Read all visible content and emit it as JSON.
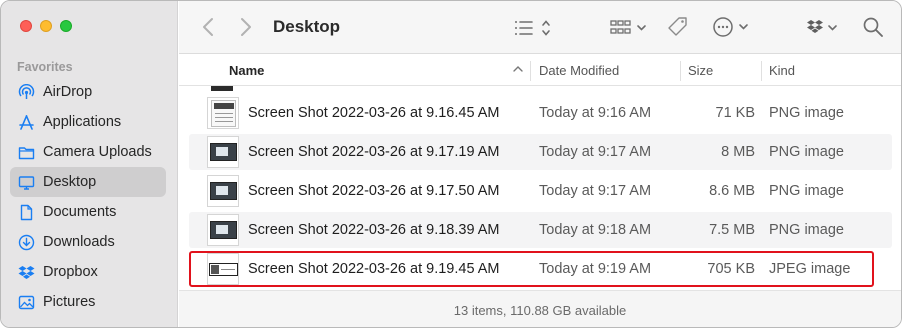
{
  "window": {
    "title": "Desktop"
  },
  "sidebar": {
    "heading": "Favorites",
    "items": [
      {
        "label": "AirDrop",
        "icon": "airdrop-icon",
        "selected": false
      },
      {
        "label": "Applications",
        "icon": "applications-icon",
        "selected": false
      },
      {
        "label": "Camera Uploads",
        "icon": "folder-icon",
        "selected": false
      },
      {
        "label": "Desktop",
        "icon": "desktop-icon",
        "selected": true
      },
      {
        "label": "Documents",
        "icon": "document-icon",
        "selected": false
      },
      {
        "label": "Downloads",
        "icon": "downloads-icon",
        "selected": false
      },
      {
        "label": "Dropbox",
        "icon": "dropbox-icon",
        "selected": false
      },
      {
        "label": "Pictures",
        "icon": "pictures-icon",
        "selected": false
      }
    ]
  },
  "toolbar": {
    "back_icon": "chevron-left-icon",
    "forward_icon": "chevron-right-icon",
    "view_icon": "list-view-icon",
    "group_icon": "group-icon",
    "tag_icon": "tag-icon",
    "action_icon": "more-icon",
    "dropbox_icon": "dropbox-icon",
    "search_icon": "search-icon"
  },
  "columns": {
    "name": "Name",
    "date": "Date Modified",
    "size": "Size",
    "kind": "Kind"
  },
  "files": [
    {
      "name": "Screen Shot 2022-03-26 at 9.16.45 AM",
      "date": "Today at 9:16 AM",
      "size": "71 KB",
      "kind": "PNG image"
    },
    {
      "name": "Screen Shot 2022-03-26 at 9.17.19 AM",
      "date": "Today at 9:17 AM",
      "size": "8 MB",
      "kind": "PNG image"
    },
    {
      "name": "Screen Shot 2022-03-26 at 9.17.50 AM",
      "date": "Today at 9:17 AM",
      "size": "8.6 MB",
      "kind": "PNG image"
    },
    {
      "name": "Screen Shot 2022-03-26 at 9.18.39 AM",
      "date": "Today at 9:18 AM",
      "size": "7.5 MB",
      "kind": "PNG image"
    },
    {
      "name": "Screen Shot 2022-03-26 at 9.19.45 AM",
      "date": "Today at 9:19 AM",
      "size": "705 KB",
      "kind": "JPEG image"
    }
  ],
  "status": {
    "text": "13 items, 110.88 GB available"
  },
  "colors": {
    "highlight": "#e1121c",
    "sidebar_bg": "#e6e5e6",
    "selected_bg": "#cfcecf"
  }
}
